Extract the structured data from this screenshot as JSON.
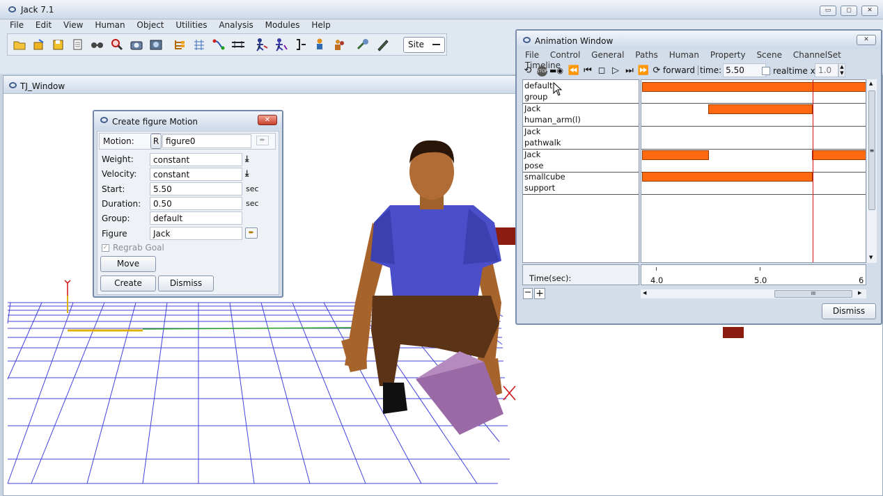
{
  "app": {
    "title": "Jack 7.1",
    "menu": [
      "File",
      "Edit",
      "View",
      "Human",
      "Object",
      "Utilities",
      "Analysis",
      "Modules",
      "Help"
    ],
    "site_label": "Site",
    "toolbar_icons": [
      "open-folder-icon",
      "open-file-icon",
      "save-icon",
      "document-icon",
      "glasses-icon",
      "magnify-icon",
      "camera-icon",
      "photo-icon",
      "hierarchy-icon",
      "grid-icon",
      "connect-icon",
      "ruler-icon",
      "human-run-icon",
      "human-select-icon",
      "bracket-icon",
      "figure-icon",
      "people-icon",
      "tools-icon",
      "pen-icon"
    ]
  },
  "tj_window": {
    "title": "TJ_Window"
  },
  "create_motion": {
    "title": "Create figure Motion",
    "motion_label": "Motion:",
    "r_label": "R",
    "motion_value": "figure0",
    "weight_label": "Weight:",
    "weight_value": "constant",
    "velocity_label": "Velocity:",
    "velocity_value": "constant",
    "start_label": "Start:",
    "start_value": "5.50",
    "start_unit": "sec",
    "duration_label": "Duration:",
    "duration_value": "0.50",
    "duration_unit": "sec",
    "group_label": "Group:",
    "group_value": "default",
    "figure_label": "Figure",
    "figure_value": "Jack",
    "regrab_label": "Regrab Goal",
    "move_label": "Move",
    "create_label": "Create",
    "dismiss_label": "Dismiss"
  },
  "animation": {
    "title": "Animation Window",
    "menu": [
      "File",
      "Control",
      "General",
      "Paths",
      "Human",
      "Property",
      "Scene",
      "ChannelSet",
      "Timeline"
    ],
    "forward_label": "forward",
    "time_label": "time:",
    "time_value": "5.50",
    "realtime_label": "realtime x",
    "realtime_value": "1.0",
    "tracks": [
      {
        "line1": "default",
        "line2": "group"
      },
      {
        "line1": "Jack",
        "line2": "human_arm(l)"
      },
      {
        "line1": "Jack",
        "line2": "pathwalk"
      },
      {
        "line1": "Jack",
        "line2": "pose"
      },
      {
        "line1": "smallcube",
        "line2": "support"
      }
    ],
    "time_axis_label": "Time(sec):",
    "ticks": [
      "4.0",
      "5.0",
      "6"
    ],
    "dismiss_label": "Dismiss",
    "playhead_time": 5.5
  },
  "colors": {
    "bar": "#ff6a10",
    "shirt": "#4a4fc9",
    "grid": "#1c1cd8",
    "cube": "#9a6aa6"
  }
}
